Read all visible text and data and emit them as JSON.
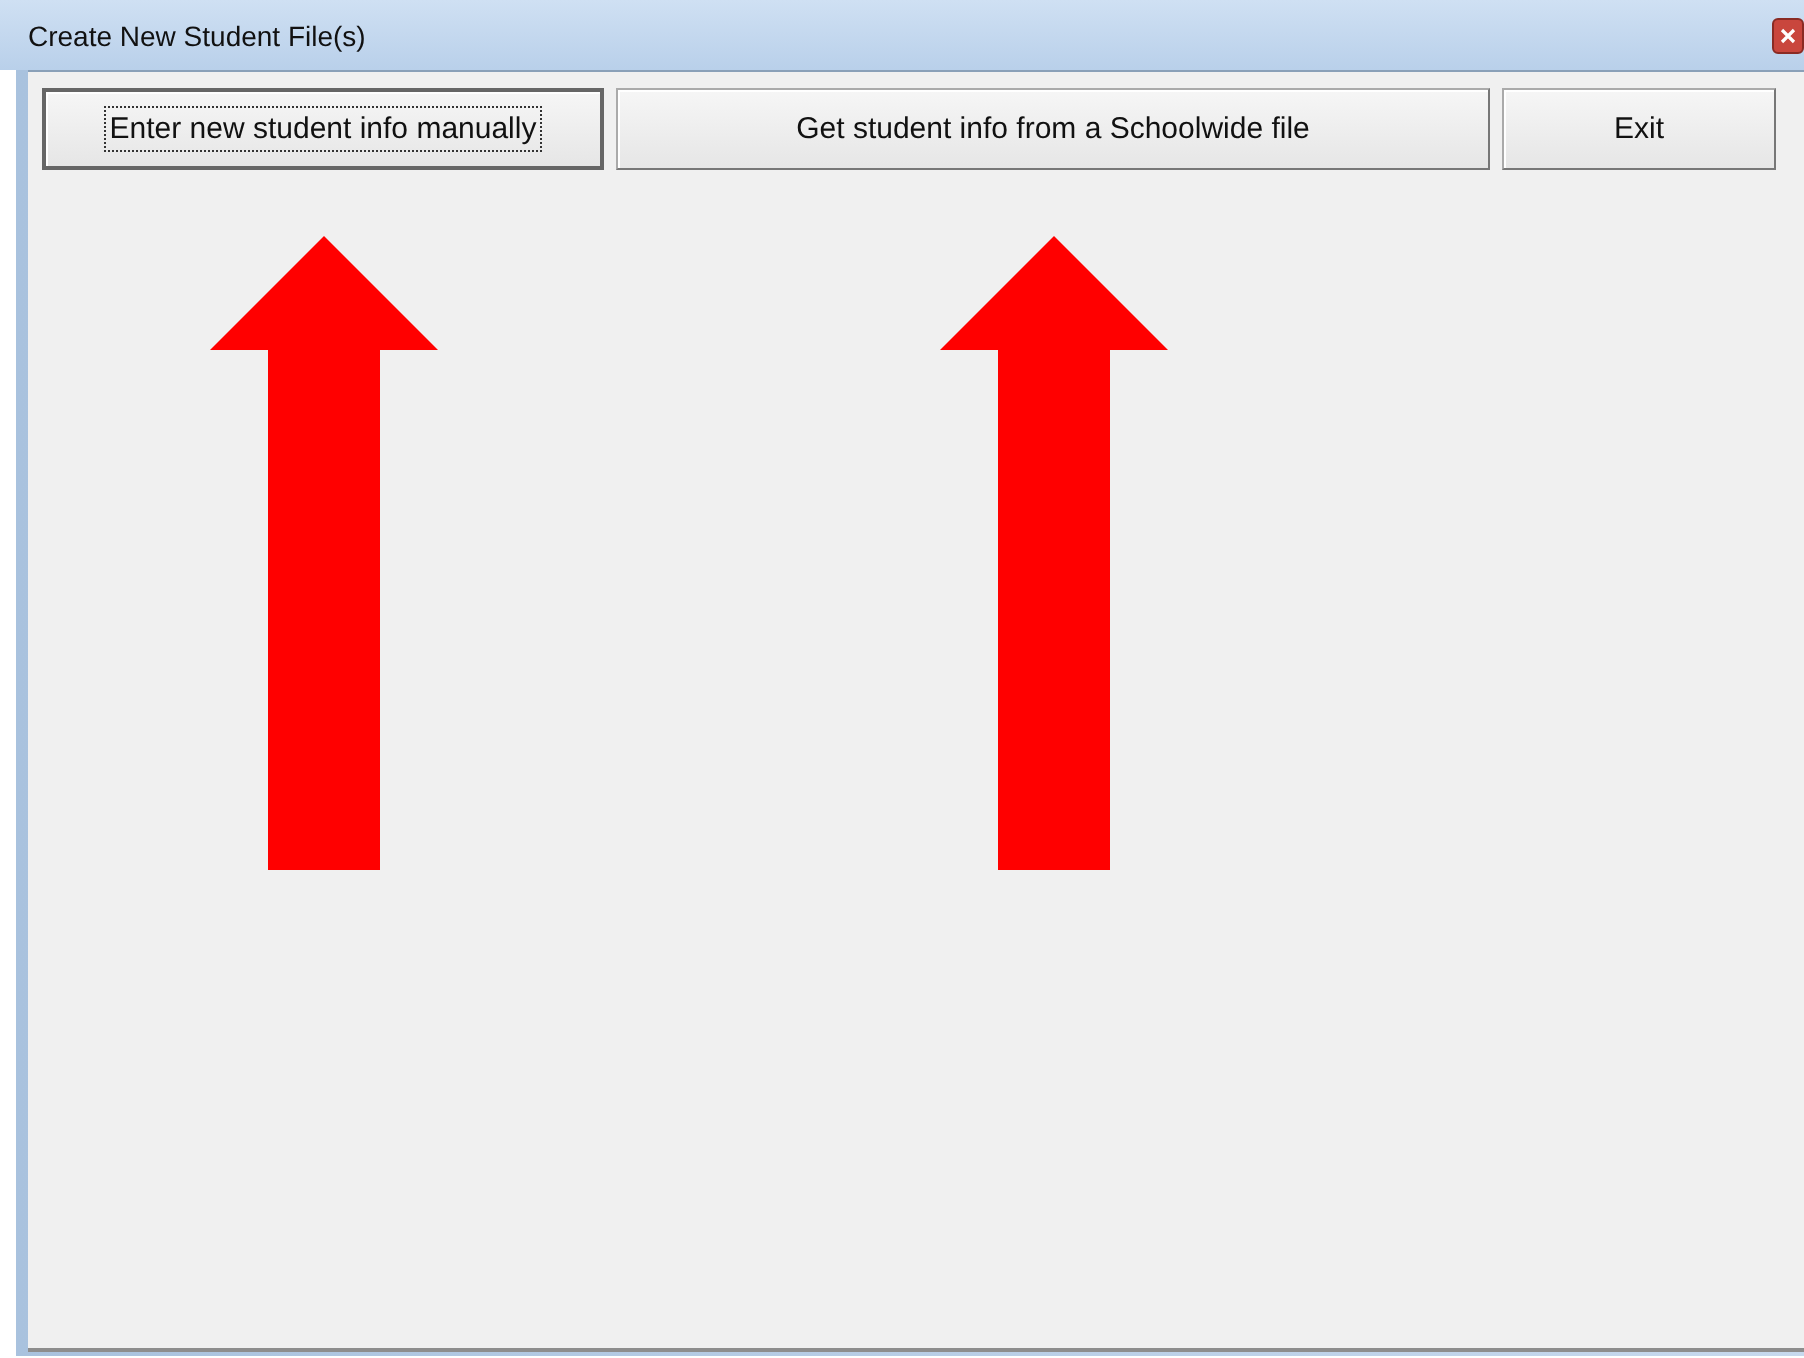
{
  "window": {
    "title": "Create New Student File(s)"
  },
  "buttons": [
    {
      "label": "Enter new student info manually",
      "focused": true,
      "arrow": true
    },
    {
      "label": "Get student info from a Schoolwide file",
      "focused": false,
      "arrow": true
    },
    {
      "label": "Exit",
      "focused": false,
      "arrow": false
    }
  ]
}
